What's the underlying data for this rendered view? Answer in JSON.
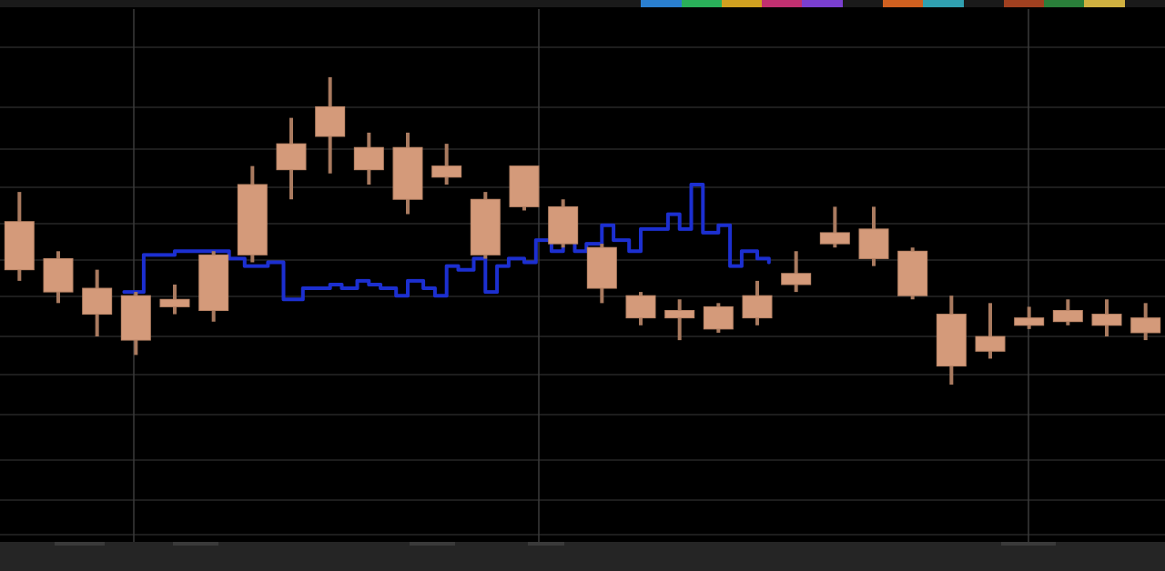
{
  "toolbar": {
    "labels": [
      "",
      "",
      "",
      "",
      "",
      ""
    ]
  },
  "colors": {
    "background": "#000000",
    "grid": "#3a3a3a",
    "candle": "#d49a7a",
    "wick": "#a97a5f",
    "line": "#1c2fd0"
  },
  "chart_data": {
    "type": "candlestick",
    "title": "",
    "xlabel": "",
    "ylabel": "",
    "ylim": [
      0,
      100
    ],
    "grid": true,
    "candles": [
      {
        "x": 1,
        "open": 52,
        "close": 65,
        "high": 73,
        "low": 49
      },
      {
        "x": 2,
        "open": 46,
        "close": 55,
        "high": 57,
        "low": 43
      },
      {
        "x": 3,
        "open": 40,
        "close": 47,
        "high": 52,
        "low": 34
      },
      {
        "x": 4,
        "open": 33,
        "close": 45,
        "high": 46,
        "low": 29
      },
      {
        "x": 5,
        "open": 44,
        "close": 42,
        "high": 48,
        "low": 40
      },
      {
        "x": 6,
        "open": 41,
        "close": 56,
        "high": 57,
        "low": 38
      },
      {
        "x": 7,
        "open": 56,
        "close": 75,
        "high": 80,
        "low": 54
      },
      {
        "x": 8,
        "open": 79,
        "close": 86,
        "high": 93,
        "low": 71
      },
      {
        "x": 9,
        "open": 88,
        "close": 96,
        "high": 104,
        "low": 78
      },
      {
        "x": 10,
        "open": 79,
        "close": 85,
        "high": 89,
        "low": 75
      },
      {
        "x": 11,
        "open": 71,
        "close": 85,
        "high": 89,
        "low": 67
      },
      {
        "x": 12,
        "open": 77,
        "close": 80,
        "high": 86,
        "low": 75
      },
      {
        "x": 13,
        "open": 56,
        "close": 71,
        "high": 73,
        "low": 55
      },
      {
        "x": 14,
        "open": 69,
        "close": 80,
        "high": 80,
        "low": 68
      },
      {
        "x": 15,
        "open": 59,
        "close": 69,
        "high": 71,
        "low": 58
      },
      {
        "x": 16,
        "open": 47,
        "close": 58,
        "high": 59,
        "low": 43
      },
      {
        "x": 17,
        "open": 45,
        "close": 39,
        "high": 46,
        "low": 37
      },
      {
        "x": 18,
        "open": 41,
        "close": 39,
        "high": 44,
        "low": 33
      },
      {
        "x": 19,
        "open": 36,
        "close": 42,
        "high": 43,
        "low": 35
      },
      {
        "x": 20,
        "open": 39,
        "close": 45,
        "high": 49,
        "low": 37
      },
      {
        "x": 21,
        "open": 48,
        "close": 51,
        "high": 57,
        "low": 46
      },
      {
        "x": 22,
        "open": 59,
        "close": 62,
        "high": 69,
        "low": 58
      },
      {
        "x": 23,
        "open": 55,
        "close": 63,
        "high": 69,
        "low": 53
      },
      {
        "x": 24,
        "open": 45,
        "close": 57,
        "high": 58,
        "low": 44
      },
      {
        "x": 25,
        "open": 26,
        "close": 40,
        "high": 45,
        "low": 21
      },
      {
        "x": 26,
        "open": 30,
        "close": 34,
        "high": 43,
        "low": 28
      },
      {
        "x": 27,
        "open": 37,
        "close": 39,
        "high": 42,
        "low": 36
      },
      {
        "x": 28,
        "open": 38,
        "close": 41,
        "high": 44,
        "low": 37
      },
      {
        "x": 29,
        "open": 37,
        "close": 40,
        "high": 44,
        "low": 34
      },
      {
        "x": 30,
        "open": 35,
        "close": 39,
        "high": 43,
        "low": 33
      }
    ],
    "series": [
      {
        "x": [
          3.7,
          3.9,
          4.2,
          4.6,
          5.0,
          5.3,
          5.6,
          6.0,
          6.4,
          6.8,
          7.0,
          7.4,
          7.8,
          8.0,
          8.3,
          8.6,
          9.0,
          9.3,
          9.7,
          10.0,
          10.3,
          10.7,
          11.0,
          11.4,
          11.7,
          12.0,
          12.3,
          12.7,
          13.0,
          13.3,
          13.6,
          14.0,
          14.3,
          14.7,
          15.0,
          15.3,
          15.6,
          16.0,
          16.3,
          16.7,
          17.0,
          17.3,
          17.7,
          18.0,
          18.3,
          18.6,
          19.0,
          19.3,
          19.6,
          20.0,
          20.3
        ],
        "y": [
          46,
          46,
          56,
          56,
          57,
          57,
          57,
          57,
          55,
          53,
          53,
          54,
          44,
          44,
          47,
          47,
          48,
          47,
          49,
          48,
          47,
          45,
          49,
          47,
          45,
          53,
          52,
          55,
          46,
          53,
          55,
          54,
          60,
          57,
          63,
          57,
          59,
          64,
          60,
          57,
          63,
          63,
          67,
          63,
          75,
          62,
          64,
          53,
          57,
          55,
          54
        ]
      }
    ]
  }
}
